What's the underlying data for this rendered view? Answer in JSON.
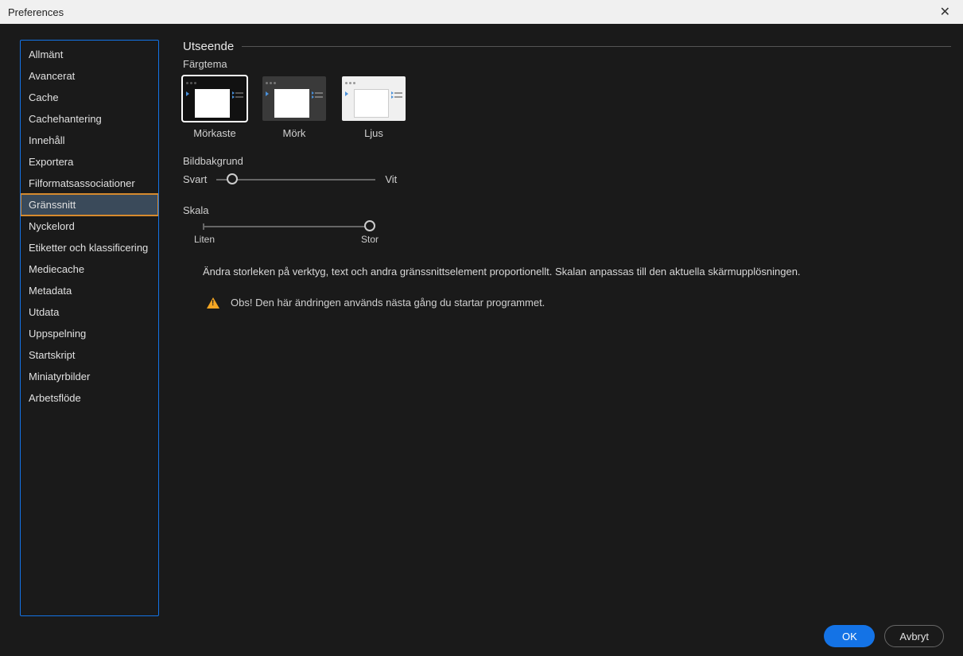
{
  "window": {
    "title": "Preferences"
  },
  "sidebar": {
    "items": [
      {
        "label": "Allmänt"
      },
      {
        "label": "Avancerat"
      },
      {
        "label": "Cache"
      },
      {
        "label": "Cachehantering"
      },
      {
        "label": "Innehåll"
      },
      {
        "label": "Exportera"
      },
      {
        "label": "Filformatsassociationer"
      },
      {
        "label": "Gränssnitt"
      },
      {
        "label": "Nyckelord"
      },
      {
        "label": "Etiketter och klassificering"
      },
      {
        "label": "Mediecache"
      },
      {
        "label": "Metadata"
      },
      {
        "label": "Utdata"
      },
      {
        "label": "Uppspelning"
      },
      {
        "label": "Startskript"
      },
      {
        "label": "Miniatyrbilder"
      },
      {
        "label": "Arbetsflöde"
      }
    ],
    "selected_index": 7
  },
  "appearance": {
    "section_title": "Utseende",
    "color_theme_label": "Färgtema",
    "themes": [
      {
        "name": "Mörkaste"
      },
      {
        "name": "Mörk"
      },
      {
        "name": "Ljus"
      }
    ],
    "selected_theme_index": 0,
    "image_bg_label": "Bildbakgrund",
    "bg_left": "Svart",
    "bg_right": "Vit",
    "scale_label": "Skala",
    "scale_small": "Liten",
    "scale_large": "Stor",
    "scale_desc": "Ändra storleken på verktyg, text och andra gränssnittselement proportionellt. Skalan anpassas till den aktuella skärmupplösningen.",
    "warning": "Obs! Den här ändringen används nästa gång du startar programmet."
  },
  "footer": {
    "ok": "OK",
    "cancel": "Avbryt"
  }
}
